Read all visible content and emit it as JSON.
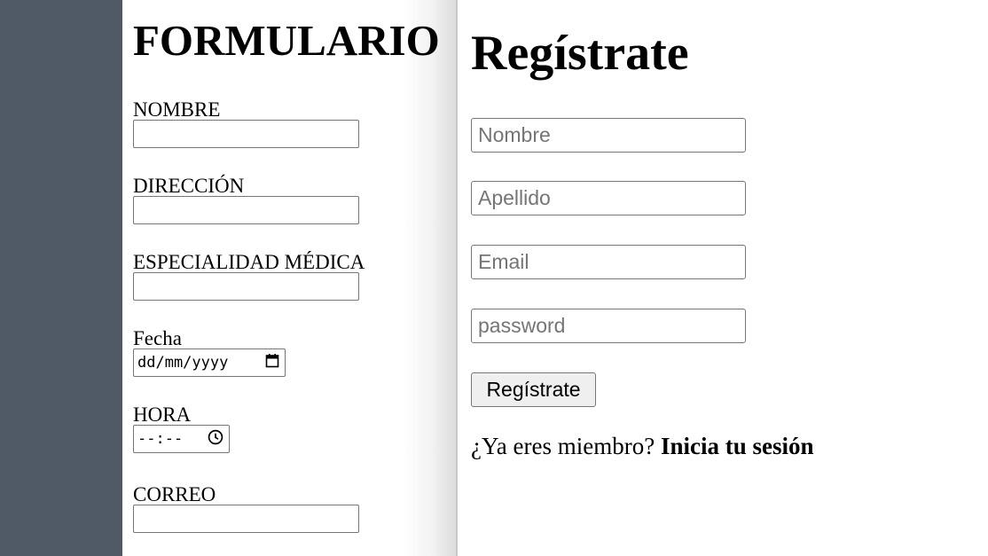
{
  "form": {
    "title": "FORMULARIO",
    "fields": [
      {
        "label": "NOMBRE",
        "type": "text",
        "value": ""
      },
      {
        "label": "DIRECCIÓN",
        "type": "text",
        "value": ""
      },
      {
        "label": "ESPECIALIDAD MÉDICA",
        "type": "text",
        "value": ""
      },
      {
        "label": "Fecha",
        "type": "date",
        "placeholder": "dd/mm/yyyy"
      },
      {
        "label": "HORA",
        "type": "time",
        "placeholder": "--:--"
      },
      {
        "label": "CORREO",
        "type": "text",
        "value": ""
      }
    ]
  },
  "register": {
    "title": "Regístrate",
    "name_placeholder": "Nombre",
    "lastname_placeholder": "Apellido",
    "email_placeholder": "Email",
    "password_placeholder": "password",
    "button_label": "Regístrate",
    "member_text": "¿Ya eres miembro?",
    "login_link": "Inicia tu sesión"
  },
  "icons": {
    "date_picker": "calendar-icon",
    "time_picker": "clock-icon"
  },
  "colors": {
    "sidebar": "#4f5a66",
    "background": "#ffffff",
    "input_border": "#767676",
    "button_bg": "#efefef",
    "placeholder": "#757575"
  }
}
